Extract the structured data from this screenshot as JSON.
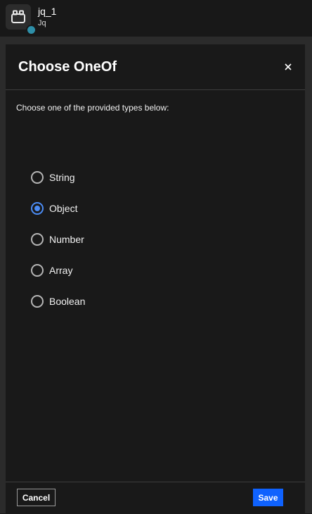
{
  "node": {
    "name": "jq_1",
    "type": "Jq",
    "icon": "jq-node-icon",
    "status_color": "#2e8fa8"
  },
  "modal": {
    "title": "Choose OneOf",
    "close_label": "×",
    "instructions": "Choose one of the provided types below:",
    "options": [
      {
        "label": "String",
        "checked": false
      },
      {
        "label": "Object",
        "checked": true
      },
      {
        "label": "Number",
        "checked": false
      },
      {
        "label": "Array",
        "checked": false
      },
      {
        "label": "Boolean",
        "checked": false
      }
    ],
    "selected": "Object",
    "cancel_label": "Cancel",
    "save_label": "Save"
  },
  "colors": {
    "accent": "#0f62fe",
    "radio_selected": "#4b8cf5",
    "modal_bg": "#191919"
  }
}
